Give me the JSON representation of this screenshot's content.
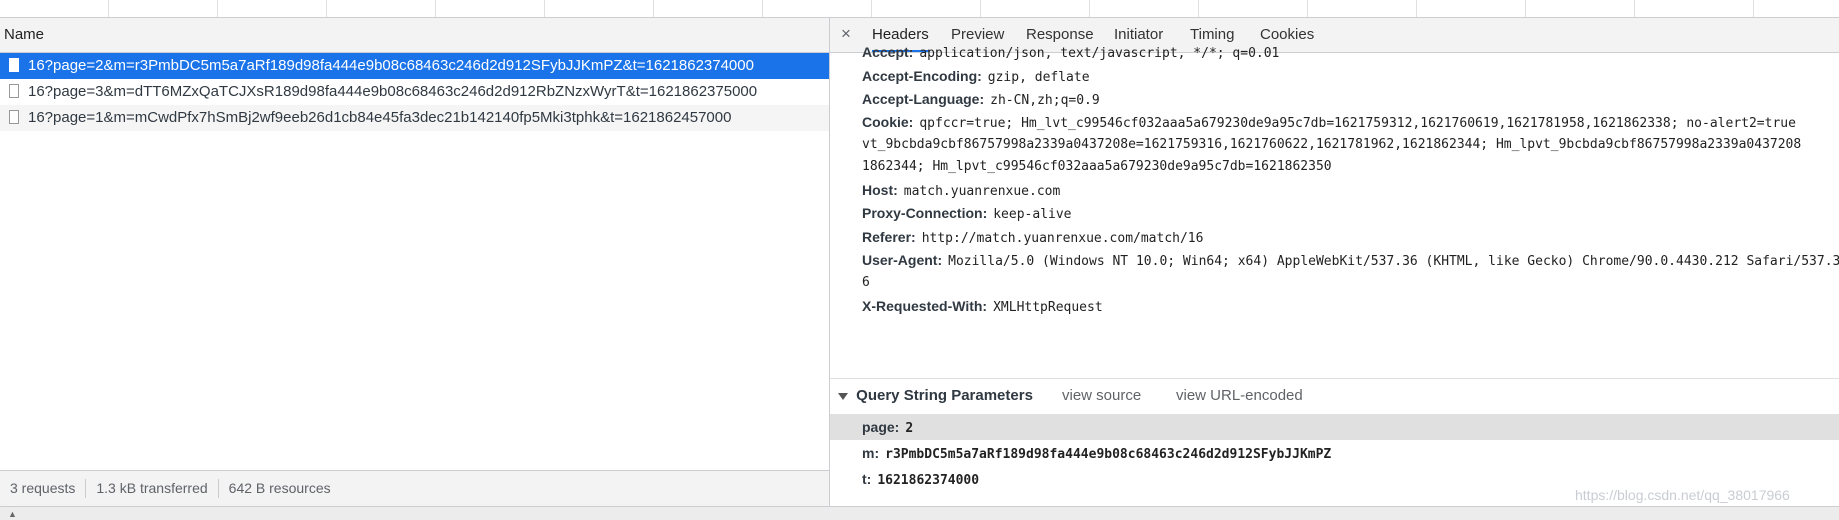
{
  "network": {
    "name_header": "Name",
    "requests": [
      {
        "name": "16?page=2&m=r3PmbDC5m5a7aRf189d98fa444e9b08c68463c246d2d912SFybJJKmPZ&t=1621862374000"
      },
      {
        "name": "16?page=3&m=dTT6MZxQaTCJXsR189d98fa444e9b08c68463c246d2d912RbZNzxWyrT&t=1621862375000"
      },
      {
        "name": "16?page=1&m=mCwdPfx7hSmBj2wf9eeb26d1cb84e45fa3dec21b142140fp5Mki3tphk&t=1621862457000"
      }
    ],
    "status": {
      "requests": "3 requests",
      "transferred": "1.3 kB transferred",
      "resources": "642 B resources"
    }
  },
  "detail": {
    "close_glyph": "×",
    "tabs": [
      "Headers",
      "Preview",
      "Response",
      "Initiator",
      "Timing",
      "Cookies"
    ],
    "active_tab": "Headers",
    "headers": {
      "accept": {
        "key": "Accept:",
        "value": "application/json, text/javascript, */*; q=0.01"
      },
      "accept_encoding": {
        "key": "Accept-Encoding:",
        "value": "gzip, deflate"
      },
      "accept_language": {
        "key": "Accept-Language:",
        "value": "zh-CN,zh;q=0.9"
      },
      "cookie": {
        "key": "Cookie:",
        "line1": "qpfccr=true; Hm_lvt_c99546cf032aaa5a679230de9a95c7db=1621759312,1621760619,1621781958,1621862338; no-alert2=true",
        "line2": "vt_9bcbda9cbf86757998a2339a0437208e=1621759316,1621760622,1621781962,1621862344; Hm_lpvt_9bcbda9cbf86757998a2339a0437208",
        "line3": "1862344; Hm_lpvt_c99546cf032aaa5a679230de9a95c7db=1621862350"
      },
      "host": {
        "key": "Host:",
        "value": "match.yuanrenxue.com"
      },
      "proxy_connection": {
        "key": "Proxy-Connection:",
        "value": "keep-alive"
      },
      "referer": {
        "key": "Referer:",
        "value": "http://match.yuanrenxue.com/match/16"
      },
      "user_agent": {
        "key": "User-Agent:",
        "value": "Mozilla/5.0 (Windows NT 10.0; Win64; x64) AppleWebKit/537.36 (KHTML, like Gecko) Chrome/90.0.4430.212 Safari/537.3",
        "wrap": "6"
      },
      "x_requested_with": {
        "key": "X-Requested-With:",
        "value": "XMLHttpRequest"
      }
    },
    "query": {
      "title": "Query String Parameters",
      "view_source": "view source",
      "view_url_encoded": "view URL-encoded",
      "params": [
        {
          "key": "page:",
          "value": "2"
        },
        {
          "key": "m:",
          "value": "r3PmbDC5m5a7aRf189d98fa444e9b08c68463c246d2d912SFybJJKmPZ"
        },
        {
          "key": "t:",
          "value": "1621862374000"
        }
      ]
    }
  },
  "watermark": "https://blog.csdn.net/qq_38017966",
  "colors": {
    "accent": "#1a73e8",
    "border": "#cbcdd1",
    "toolbar": "#f3f3f3"
  }
}
